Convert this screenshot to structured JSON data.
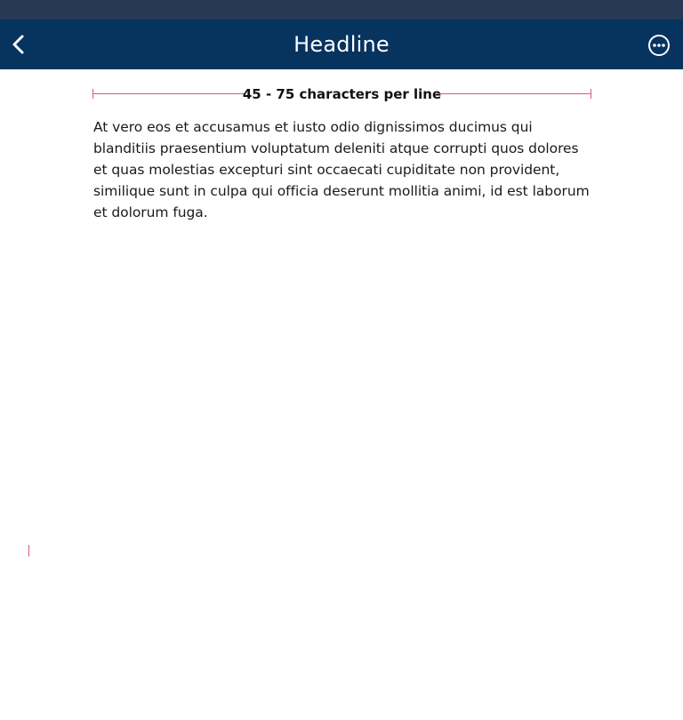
{
  "header": {
    "title": "Headline",
    "back_icon": "chevron-left-icon",
    "more_icon": "more-horizontal-circle-icon"
  },
  "measure": {
    "label": "45 - 75 characters per line"
  },
  "content": {
    "paragraph": "At vero eos et accusamus et iusto odio dignissimos ducimus qui blanditiis praesentium voluptatum deleniti atque corrupti quos dolores et quas molestias excepturi sint occaecati cupiditate non provident, similique sunt in culpa qui officia deserunt mollitia animi, id est laborum et dolorum fuga."
  },
  "colors": {
    "status_bar": "#283a53",
    "nav_bar": "#07335f",
    "accent_guide": "#e0557f",
    "text": "#1a1a1a"
  }
}
